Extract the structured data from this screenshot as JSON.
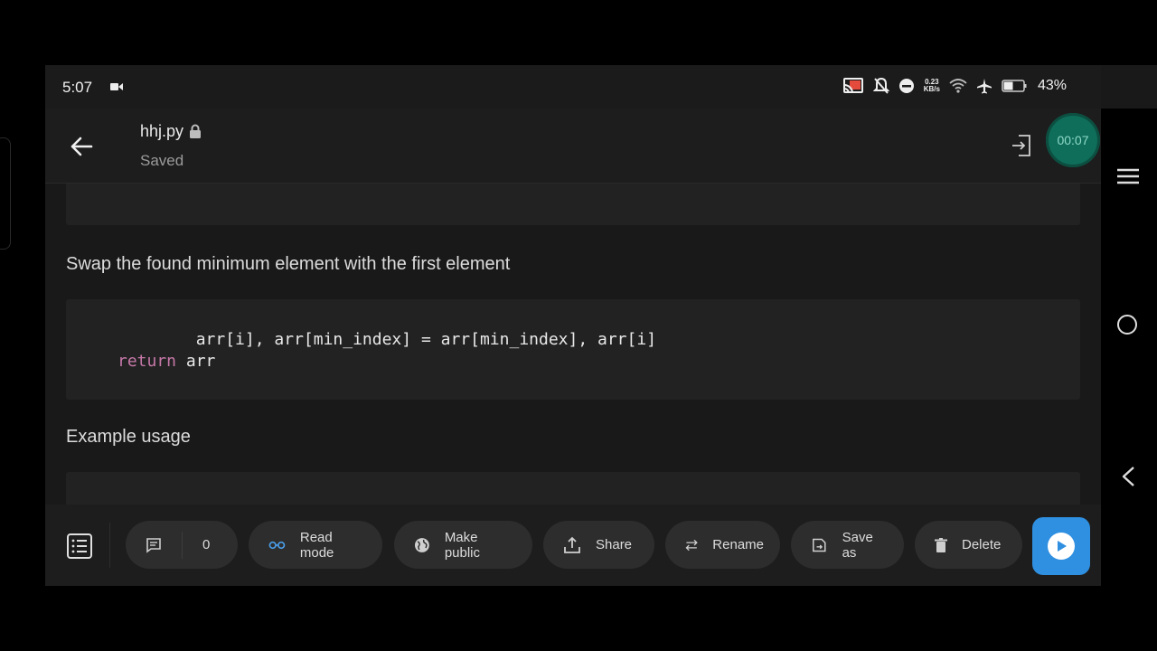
{
  "status": {
    "time": "5:07",
    "net_speed_value": "0.23",
    "net_speed_unit": "KB/s",
    "battery": "43%"
  },
  "header": {
    "file_name": "hhj.py",
    "save_state": "Saved",
    "recording_timer": "00:07"
  },
  "content": {
    "comment_swap": "Swap the found minimum element with the first element",
    "code_line_1": "        arr[i], arr[min_index] = arr[min_index], arr[i]",
    "code_kw_return": "return",
    "code_line_2_rest": " arr",
    "comment_example": "Example usage"
  },
  "toolbar": {
    "comments_count": "0",
    "read_mode": "Read mode",
    "make_public": "Make public",
    "share": "Share",
    "rename": "Rename",
    "save_as": "Save as",
    "delete": "Delete"
  },
  "colors": {
    "accent_run": "#2f8fe0",
    "recording_bubble": "#0f6e5a",
    "keyword": "#c678a8"
  }
}
